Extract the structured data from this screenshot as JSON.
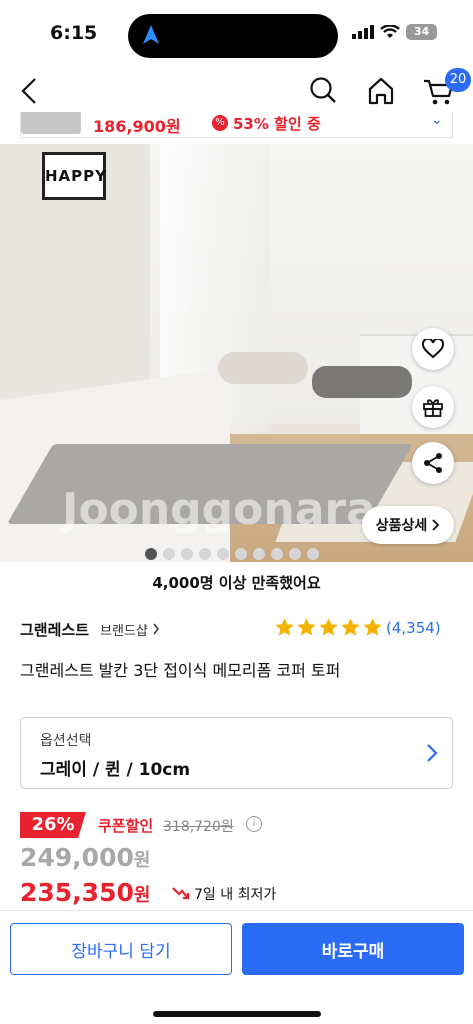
{
  "status": {
    "time": "6:15",
    "battery": "34"
  },
  "nav": {
    "cart_count": "20"
  },
  "mini_bar": {
    "price": "186,900원",
    "discount_icon": "%",
    "discount": "53% 할인 중"
  },
  "hero": {
    "poster_text": "HAPPY",
    "watermark": "Joonggonara",
    "detail_button": "상품상세",
    "slide_count": 10,
    "active_slide": 1
  },
  "satisfaction": "4,000명 이상 만족했어요",
  "brand": {
    "name": "그랜레스트",
    "shop_link": "브랜드샵",
    "rating_stars": 5,
    "review_count": "(4,354)"
  },
  "product": {
    "title": "그랜레스트 발칸 3단 접이식 메모리폼 코퍼 토퍼"
  },
  "option": {
    "label": "옵션선택",
    "value": "그레이 / 퀸 / 10cm"
  },
  "pricing": {
    "discount_badge": "26%",
    "coupon_label": "쿠폰할인",
    "original_price": "318,720원",
    "info_icon": "i",
    "sale_price": "249,000",
    "sale_unit": "원",
    "coupon_price": "235,350",
    "coupon_unit": "원",
    "lowest_label": "7일 내 최저가"
  },
  "actions": {
    "cart_label": "장바구니 담기",
    "buy_label": "바로구매"
  },
  "colors": {
    "accent": "#2b6cf6",
    "sale_red": "#e8232f",
    "star": "#f5b301"
  },
  "icons": [
    "back-arrow-icon",
    "search-icon",
    "home-icon",
    "cart-icon",
    "heart-icon",
    "gift-icon",
    "share-icon",
    "chevron-right-icon",
    "info-icon",
    "trend-down-icon"
  ]
}
